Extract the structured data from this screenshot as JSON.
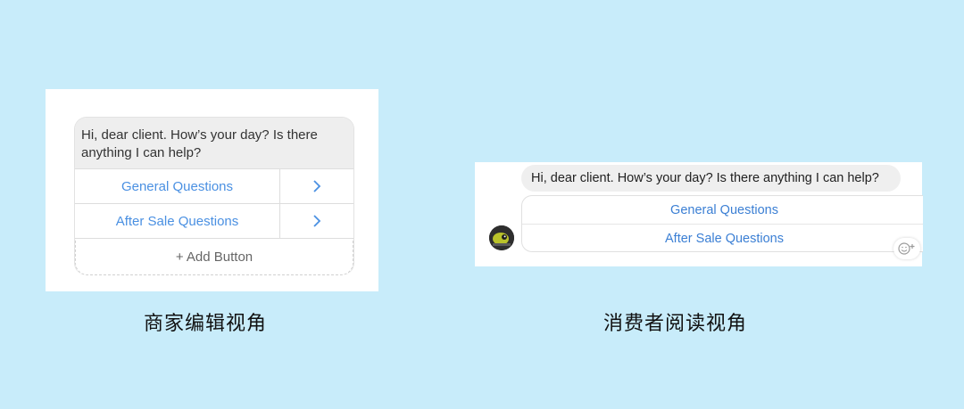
{
  "editor_view": {
    "message": "Hi, dear client. How’s your day? Is there anything I can help?",
    "buttons": [
      {
        "label": "General Questions",
        "icon": "chevron-right-icon"
      },
      {
        "label": "After Sale Questions",
        "icon": "chevron-right-icon"
      }
    ],
    "add_button_label": "+ Add Button",
    "caption": "商家编辑视角"
  },
  "reader_view": {
    "message": "Hi, dear client. How’s your day? Is there anything I can help?",
    "buttons": [
      {
        "label": "General Questions"
      },
      {
        "label": "After Sale Questions"
      }
    ],
    "avatar_icon": "avatar",
    "reaction_icon": "emoji-add-icon",
    "caption": "消费者阅读视角"
  },
  "colors": {
    "background": "#c8ecfa",
    "button_text": "#4a90e2",
    "bubble": "#eeeeee"
  }
}
